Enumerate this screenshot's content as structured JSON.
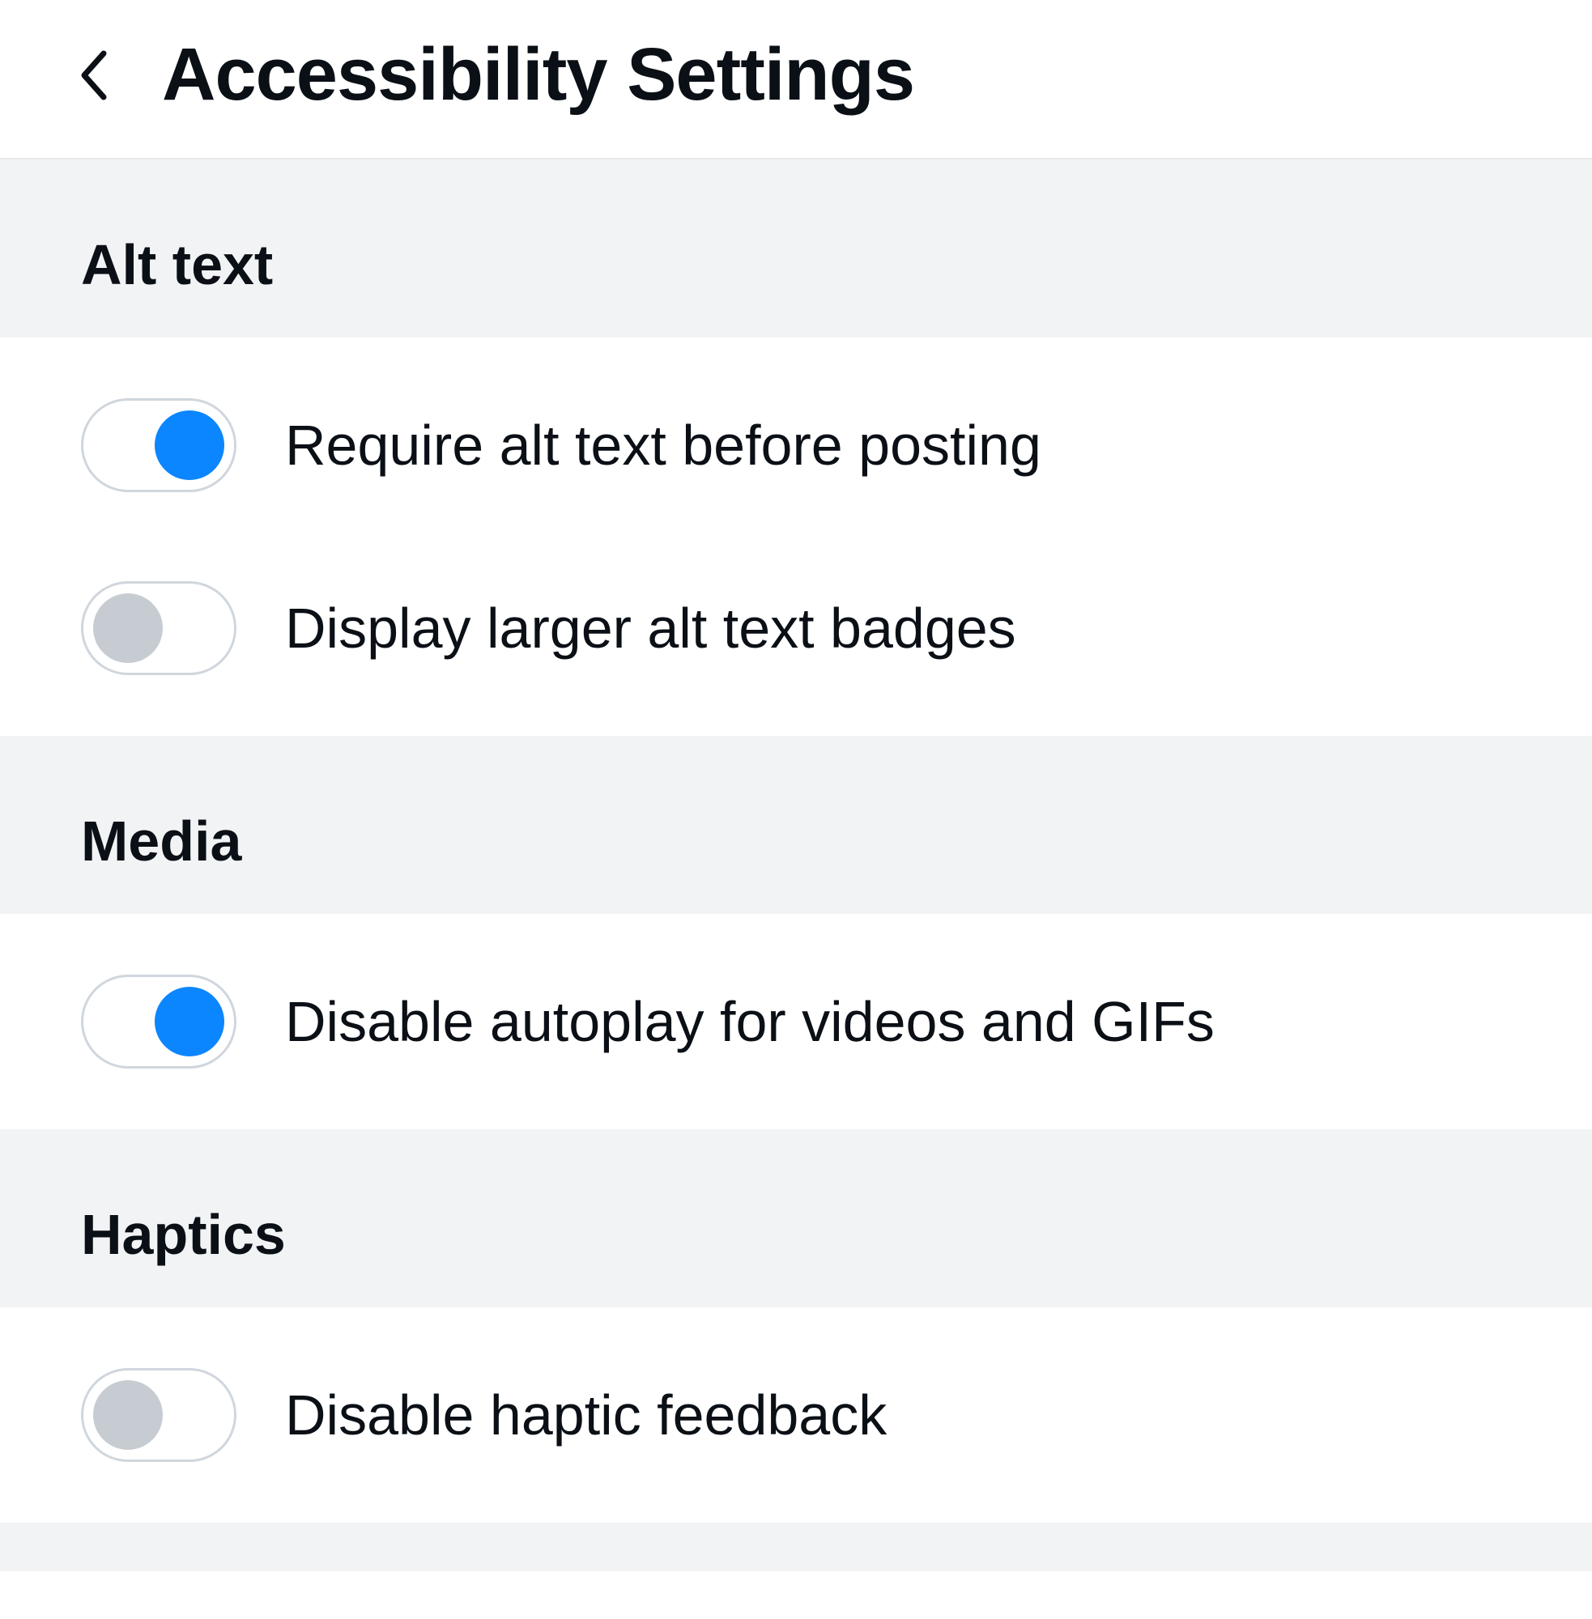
{
  "header": {
    "title": "Accessibility Settings"
  },
  "sections": [
    {
      "title": "Alt text",
      "items": [
        {
          "label": "Require alt text before posting",
          "enabled": true
        },
        {
          "label": "Display larger alt text badges",
          "enabled": false
        }
      ]
    },
    {
      "title": "Media",
      "items": [
        {
          "label": "Disable autoplay for videos and GIFs",
          "enabled": true
        }
      ]
    },
    {
      "title": "Haptics",
      "items": [
        {
          "label": "Disable haptic feedback",
          "enabled": false
        }
      ]
    }
  ]
}
